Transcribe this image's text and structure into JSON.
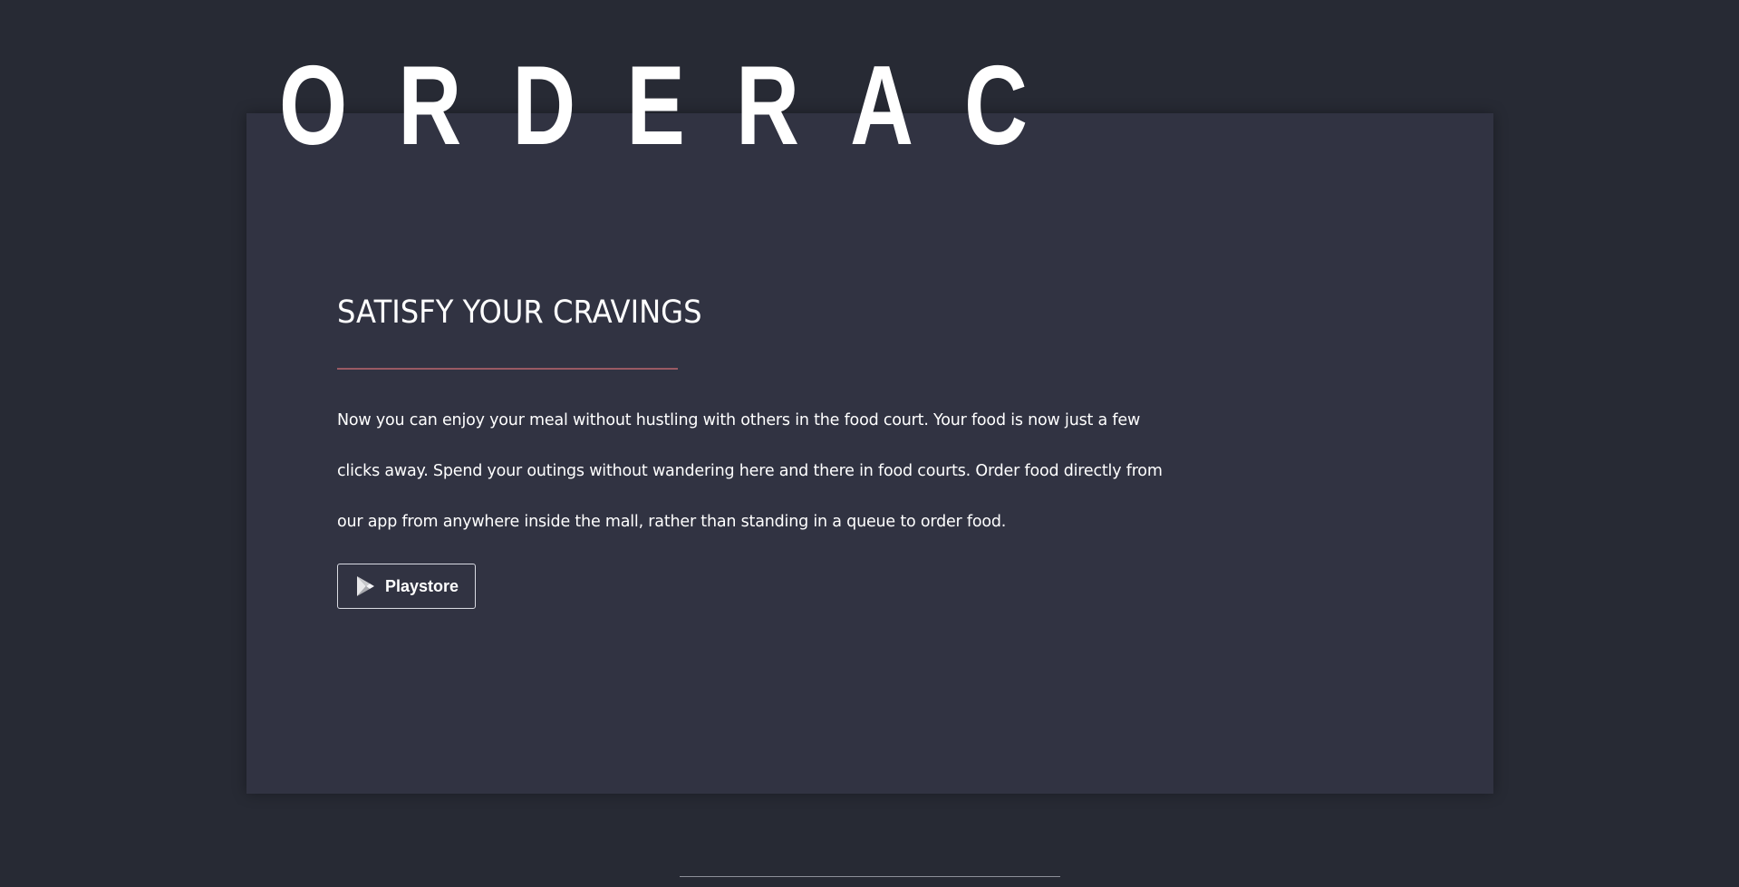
{
  "brand": {
    "name": "ORDERAC"
  },
  "hero": {
    "headline": "SATISFY YOUR CRAVINGS",
    "description": "Now you can enjoy your meal without hustling with others in the food court. Your food is now just a few clicks away. Spend your outings without wandering here and there in food courts. Order food directly from our app from anywhere inside the mall, rather than standing in a queue to order food.",
    "cta": {
      "label": "Playstore",
      "icon": "play-store-icon"
    }
  },
  "colors": {
    "page_background": "#272a34",
    "card_background": "#313342",
    "accent_divider": "#9a5a63",
    "text": "#ffffff"
  }
}
